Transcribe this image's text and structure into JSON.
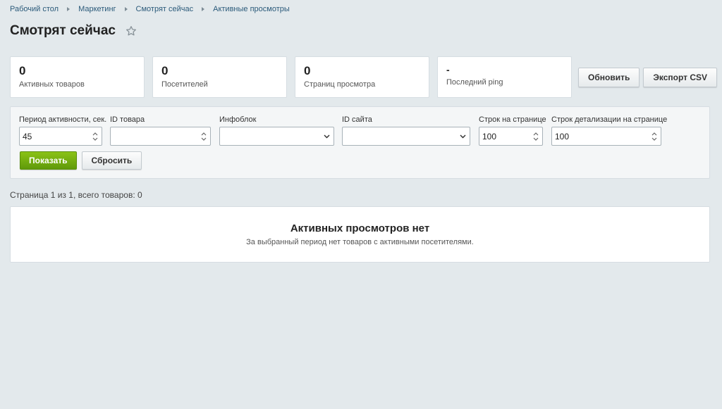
{
  "breadcrumb": [
    {
      "label": "Рабочий стол"
    },
    {
      "label": "Маркетинг"
    },
    {
      "label": "Смотрят сейчас"
    },
    {
      "label": "Активные просмотры"
    }
  ],
  "page": {
    "title": "Смотрят сейчас",
    "favorite_icon": "star-outline-icon"
  },
  "stats": {
    "active_products": {
      "value": "0",
      "label": "Активных товаров"
    },
    "visitors": {
      "value": "0",
      "label": "Посетителей"
    },
    "page_views": {
      "value": "0",
      "label": "Страниц просмотра"
    },
    "last_ping": {
      "value": "-",
      "label": "Последний ping"
    }
  },
  "actions": {
    "refresh_label": "Обновить",
    "export_label": "Экспорт CSV"
  },
  "filters": {
    "period": {
      "label": "Период активности, сек.",
      "value": "45"
    },
    "product_id": {
      "label": "ID товара",
      "value": ""
    },
    "iblock": {
      "label": "Инфоблок",
      "value": ""
    },
    "site_id": {
      "label": "ID сайта",
      "value": ""
    },
    "rows_per_page": {
      "label": "Строк на странице",
      "value": "100"
    },
    "detail_rows_per_page": {
      "label": "Строк детализации на странице",
      "value": "100"
    },
    "show_label": "Показать",
    "reset_label": "Сбросить"
  },
  "pager": {
    "info": "Страница 1 из 1, всего товаров: 0"
  },
  "empty_state": {
    "title": "Активных просмотров нет",
    "text": "За выбранный период нет товаров с активными посетителями."
  },
  "colors": {
    "background": "#e3e9ec",
    "link": "#2b5a7a",
    "primary_button": "#6ea911"
  }
}
